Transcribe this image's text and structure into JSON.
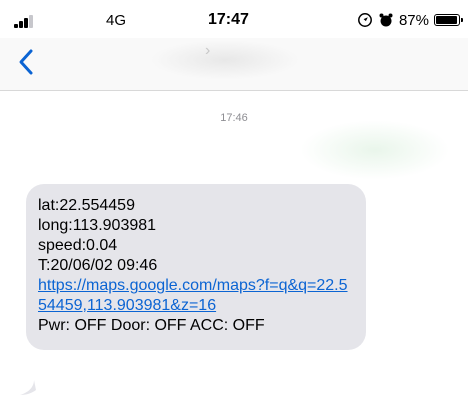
{
  "status_bar": {
    "network": "4G",
    "time": "17:47",
    "battery_percent": "87%",
    "battery_level": 0.87,
    "icons": [
      "signal-icon",
      "location-icon",
      "alarm-icon",
      "battery-icon"
    ]
  },
  "nav": {
    "back_icon": "chevron-left-icon"
  },
  "conversation": {
    "timestamp": "17:46",
    "message": {
      "lines": [
        "lat:22.554459",
        "long:113.903981",
        "speed:0.04",
        "T:20/06/02 09:46"
      ],
      "link": "https://maps.google.com/maps?f=q&q=22.554459,113.903981&z=16",
      "footer": "Pwr: OFF Door: OFF ACC: OFF"
    }
  },
  "colors": {
    "accent": "#0b64d3",
    "bubble": "#e5e5ea",
    "nav_background": "#f9f9f9",
    "timestamp": "#8e8e93"
  }
}
